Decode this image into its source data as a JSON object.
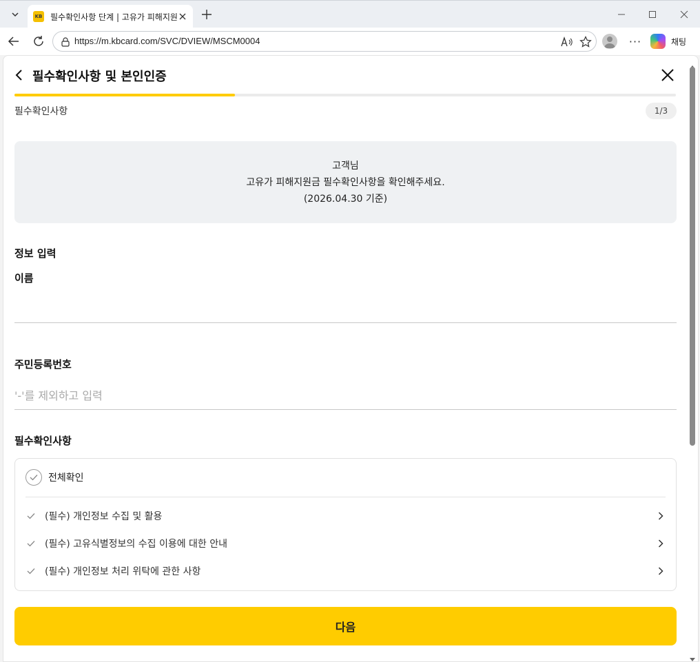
{
  "browser": {
    "tab_title": "필수확인사항 단계 | 고유가 피해지원",
    "favicon_text": "KB",
    "url": "https://m.kbcard.com/SVC/DVIEW/MSCM0004",
    "copilot_label": "채팅"
  },
  "header": {
    "title": "필수확인사항 및 본인인증"
  },
  "progress": {
    "fraction": 0.333
  },
  "step": {
    "label": "필수확인사항",
    "badge": "1/3"
  },
  "notice": {
    "line1": "고객님",
    "line2": "고유가 피해지원금 필수확인사항을 확인해주세요.",
    "line3": "(2026.04.30 기준)"
  },
  "info_section": {
    "title": "정보 입력",
    "name_label": "이름",
    "name_value": "",
    "rrn_label": "주민등록번호",
    "rrn_placeholder": "'-'를 제외하고 입력"
  },
  "agreements": {
    "title": "필수확인사항",
    "all_label": "전체확인",
    "items": [
      {
        "label": "(필수) 개인정보 수집 및 활용"
      },
      {
        "label": "(필수) 고유식별정보의 수집 이용에 대한 안내"
      },
      {
        "label": "(필수) 개인정보 처리 위탁에 관한 사항"
      }
    ]
  },
  "next_button": {
    "label": "다음"
  },
  "colors": {
    "accent": "#ffcc00",
    "notice_bg": "#eff1f3"
  }
}
